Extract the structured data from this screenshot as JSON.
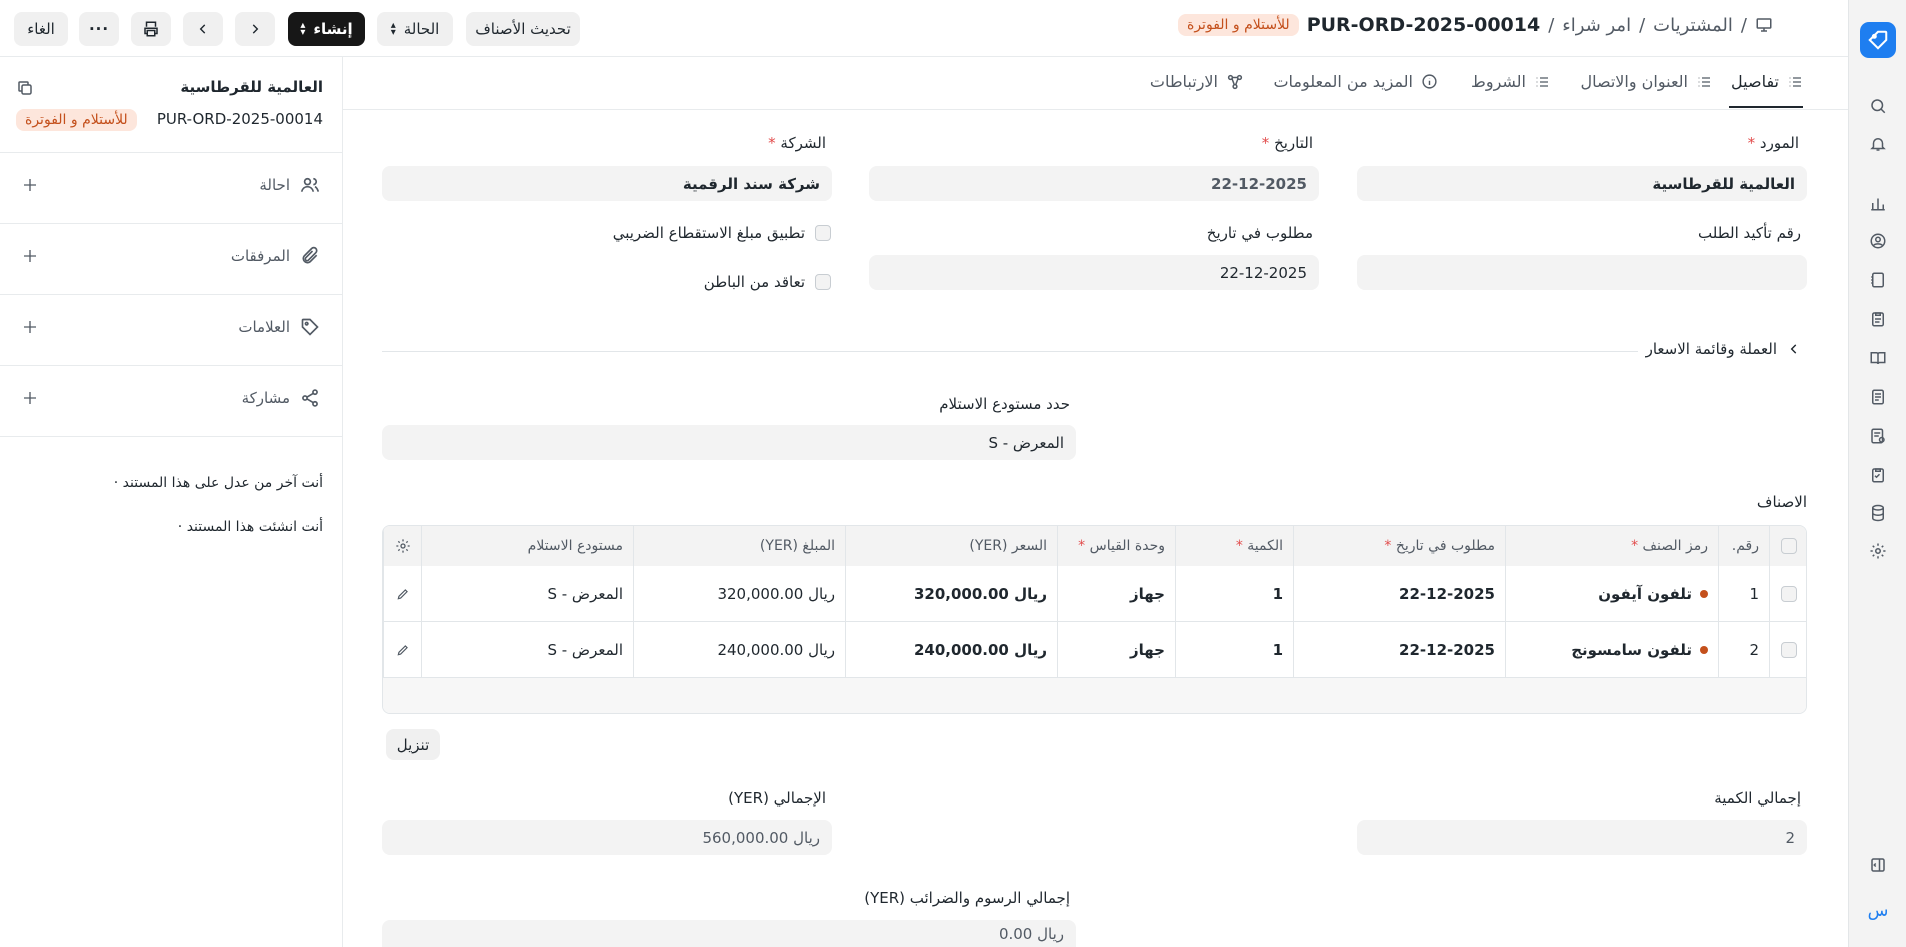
{
  "sidebar": {
    "bottom_letter": "س"
  },
  "header": {
    "breadcrumb": [
      "المشتريات",
      "امر شراء"
    ],
    "doc_id": "PUR-ORD-2025-00014",
    "status": "للأستلام و الفوترة",
    "buttons": {
      "update_items": "تحديث الأصناف",
      "status": "الحالة",
      "create": "إنشاء",
      "cancel": "الغاء"
    }
  },
  "left_panel": {
    "supplier_name": "العالمية للقرطاسية",
    "doc_id": "PUR-ORD-2025-00014",
    "status": "للأستلام و الفوترة",
    "rows": [
      {
        "label": "احالة",
        "icon": "users-icon"
      },
      {
        "label": "المرفقات",
        "icon": "paperclip-icon"
      },
      {
        "label": "العلامات",
        "icon": "tag-icon"
      },
      {
        "label": "مشاركة",
        "icon": "share-icon"
      }
    ],
    "activity": [
      "أنت آخر من عدل على هذا المستند ·",
      "أنت انشئت هذا المستند ·"
    ]
  },
  "tabs": [
    "تفاصيل",
    "العنوان والاتصال",
    "الشروط",
    "المزيد من المعلومات",
    "الارتباطات"
  ],
  "form": {
    "supplier": {
      "label": "المورد",
      "value": "العالمية للقرطاسية"
    },
    "date": {
      "label": "التاريخ",
      "value": "22-12-2025"
    },
    "company": {
      "label": "الشركة",
      "value": "شركة سند الرقمية"
    },
    "order_confirmation_no": {
      "label": "رقم تأكيد الطلب",
      "value": ""
    },
    "required_by": {
      "label": "مطلوب في تاريخ",
      "value": "22-12-2025"
    },
    "apply_tds": "تطبيق مبلغ الاستقطاع الضريبي",
    "is_subcontracted": "تعاقد من الباطن",
    "currency_section": "العملة وقائمة الاسعار",
    "set_warehouse": {
      "label": "حدد مستودع الاستلام",
      "value": "المعرض - S"
    },
    "items_label": "الاصناف",
    "download": "تنزيل",
    "total_qty": {
      "label": "إجمالي الكمية",
      "value": "2"
    },
    "total": {
      "label": "الإجمالي (YER)",
      "value": "ريال 560,000.00"
    },
    "total_taxes": {
      "label": "إجمالي الرسوم والضرائب (YER)",
      "value": "ريال 0.00"
    }
  },
  "items_table": {
    "headers": [
      "رقم.",
      "رمز الصنف",
      "مطلوب في تاريخ",
      "الكمية",
      "وحدة القياس",
      "السعر (YER)",
      "المبلغ (YER)",
      "مستودع الاستلام"
    ],
    "rows": [
      {
        "no": "1",
        "item": "تلفون آيفون",
        "date": "22-12-2025",
        "qty": "1",
        "uom": "جهاز",
        "rate": "ريال 320,000.00",
        "amount": "ريال 320,000.00",
        "warehouse": "المعرض - S"
      },
      {
        "no": "2",
        "item": "تلفون سامسونج",
        "date": "22-12-2025",
        "qty": "1",
        "uom": "جهاز",
        "rate": "ريال 240,000.00",
        "amount": "ريال 240,000.00",
        "warehouse": "المعرض - S"
      }
    ]
  },
  "colors": {
    "accent": "#1e7ef0",
    "status_bg": "#fde6dc",
    "status_fg": "#c4501c",
    "dark_button": "#171717"
  }
}
